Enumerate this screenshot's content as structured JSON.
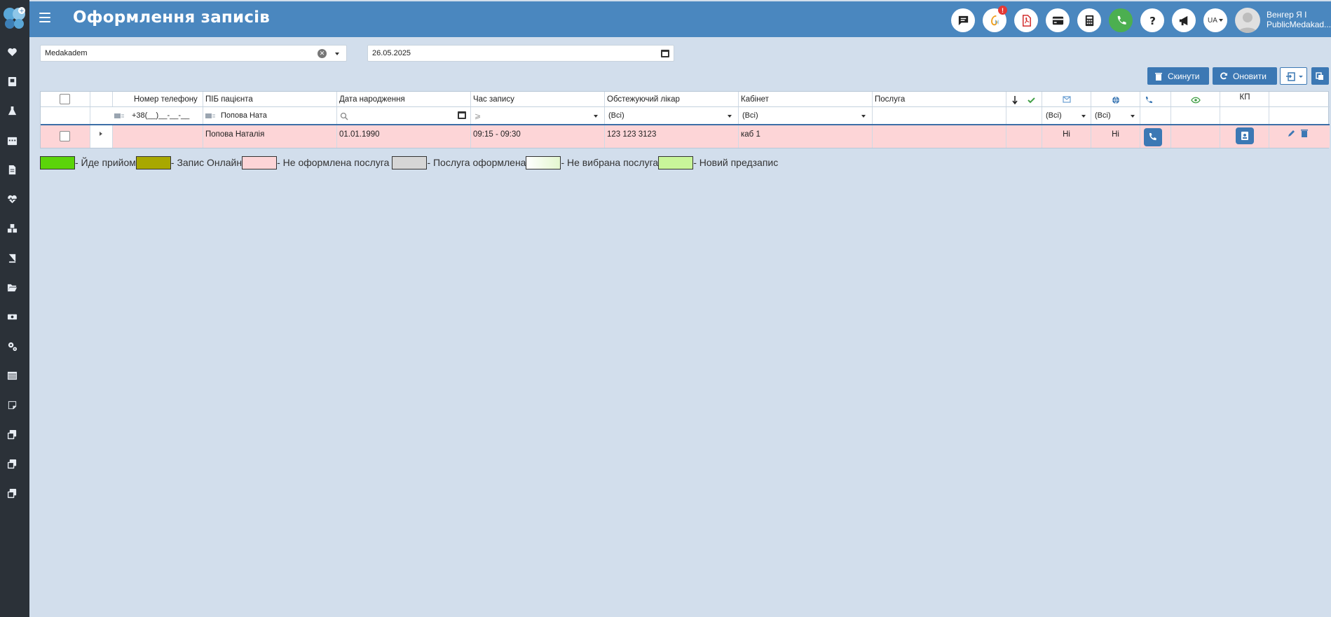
{
  "header": {
    "title": "Оформлення записів",
    "notification_badge": "!",
    "language": "UA",
    "user_name": "Венгер Я І",
    "user_org": "PublicMedakad..."
  },
  "filters": {
    "clinic_value": "Medakadem",
    "date_value": "26.05.2025"
  },
  "actions": {
    "reset_label": "Скинути",
    "refresh_label": "Оновити"
  },
  "grid": {
    "columns": {
      "phone": "Номер телефону",
      "patient": "ПІБ пацієнта",
      "birthdate": "Дата народження",
      "time": "Час запису",
      "doctor": "Обстежуючий лікар",
      "room": "Кабінет",
      "service": "Послуга",
      "kp": "КП"
    },
    "filter_row": {
      "phone_mask": "+38(__)__-__-__",
      "patient_value": "Попова Ната",
      "time_placeholder": "⩾",
      "doctor_value": "(Всі)",
      "room_value": "(Всі)",
      "email_value": "(Всі)",
      "web_value": "(Всі)"
    },
    "rows": [
      {
        "phone": "",
        "patient": "Попова Наталія",
        "birthdate": "01.01.1990",
        "time": "09:15 - 09:30",
        "doctor": "123 123 3123",
        "room": "каб 1",
        "service": "",
        "email": "Ні",
        "web": "Ні"
      }
    ]
  },
  "legend": [
    {
      "color": "#5bd40a",
      "label": "- Йде прийом"
    },
    {
      "color": "#a8a800",
      "label": "- Запис Онлайн"
    },
    {
      "color": "#fdd5d7",
      "label": "- Не оформлена послуга"
    },
    {
      "color": "#d6d6d6",
      "label": "- Послуга оформлена"
    },
    {
      "color": "#f2fbe7",
      "label": "- Не вибрана послуга"
    },
    {
      "color": "#c9f59a",
      "label": "- Новий предзапис"
    }
  ],
  "colors": {
    "header": "#4a87bf",
    "sidebar": "#2b3138",
    "background": "#d2deec",
    "accent_button": "#3c78b4",
    "row_not_processed": "#fdd5d7"
  }
}
